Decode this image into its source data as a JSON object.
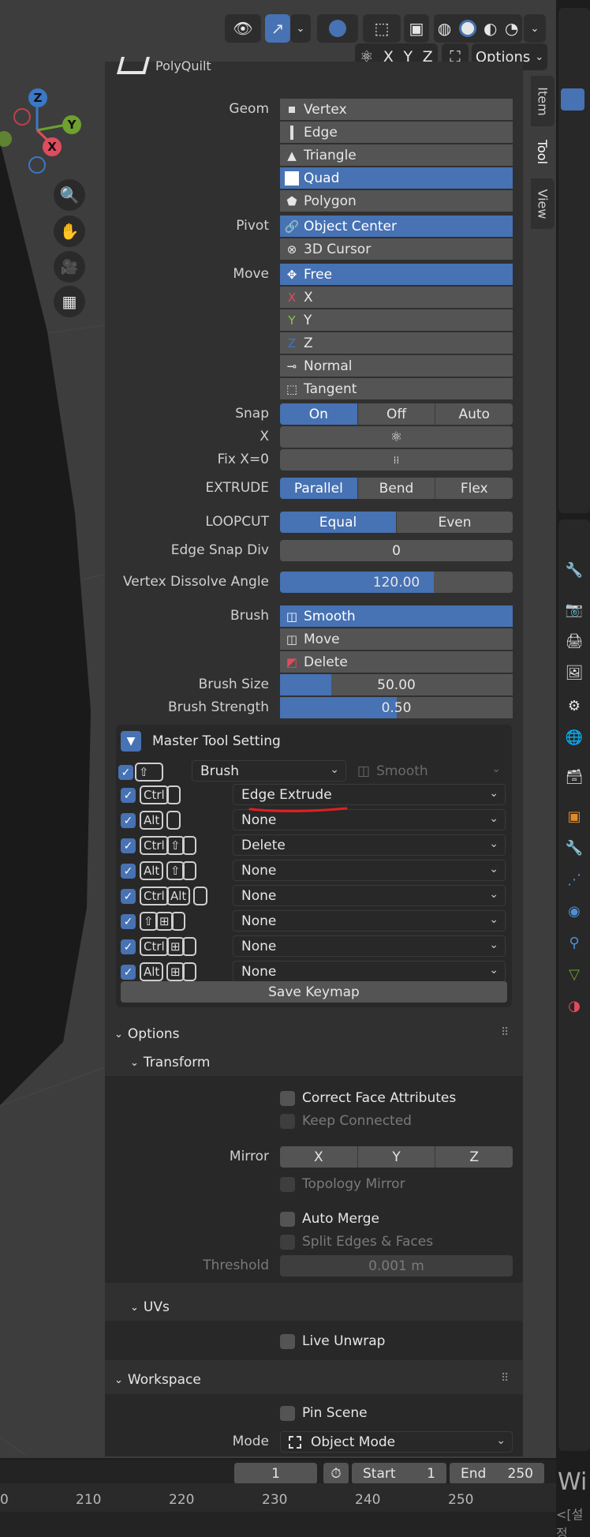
{
  "header": {
    "options_label": "Options",
    "mirror_axes": [
      "X",
      "Y",
      "Z"
    ]
  },
  "gizmo": {
    "z": "Z",
    "y": "Y",
    "x": "X"
  },
  "tool": {
    "name": "PolyQuilt"
  },
  "tabs": [
    "Item",
    "Tool",
    "View"
  ],
  "panel": {
    "geom_label": "Geom",
    "geom_items": [
      "Vertex",
      "Edge",
      "Triangle",
      "Quad",
      "Polygon"
    ],
    "pivot_label": "Pivot",
    "pivot_items": [
      "Object Center",
      "3D Cursor"
    ],
    "move_label": "Move",
    "move_items": [
      "Free",
      "X",
      "Y",
      "Z",
      "Normal",
      "Tangent"
    ],
    "move_icons": {
      "x": "X",
      "y": "Y",
      "z": "Z"
    },
    "snap_label": "Snap",
    "snap_options": [
      "On",
      "Off",
      "Auto"
    ],
    "x_label": "X",
    "fixx_label": "Fix X=0",
    "extrude_label": "EXTRUDE",
    "extrude_options": [
      "Parallel",
      "Bend",
      "Flex"
    ],
    "loopcut_label": "LOOPCUT",
    "loopcut_options": [
      "Equal",
      "Even"
    ],
    "edge_snap_label": "Edge Snap Div",
    "edge_snap_value": "0",
    "dissolve_label": "Vertex Dissolve Angle",
    "dissolve_value": "120.00",
    "dissolve_fill": 0.66,
    "brush_label": "Brush",
    "brush_items": [
      "Smooth",
      "Move",
      "Delete"
    ],
    "brush_size_label": "Brush Size",
    "brush_size_value": "50.00",
    "brush_size_fill": 0.22,
    "brush_strength_label": "Brush Strength",
    "brush_strength_value": "0.50",
    "brush_strength_fill": 0.5
  },
  "master": {
    "title": "Master Tool Setting",
    "brush_dropdown": "Brush",
    "brush_smooth": "Smooth",
    "rows": [
      {
        "keys": [
          "Ctrl"
        ],
        "action": "Edge Extrude"
      },
      {
        "keys": [
          "Alt"
        ],
        "action": "None"
      },
      {
        "keys": [
          "Ctrl",
          "⇧"
        ],
        "action": "Delete"
      },
      {
        "keys": [
          "Alt",
          "⇧"
        ],
        "action": "None"
      },
      {
        "keys": [
          "Ctrl",
          "Alt"
        ],
        "action": "None"
      },
      {
        "keys": [
          "⇧",
          "⊞"
        ],
        "action": "None"
      },
      {
        "keys": [
          "Ctrl",
          "⊞"
        ],
        "action": "None"
      },
      {
        "keys": [
          "Alt",
          "⊞"
        ],
        "action": "None"
      }
    ],
    "save_label": "Save Keymap"
  },
  "options": {
    "title": "Options",
    "transform_title": "Transform",
    "correct_face": "Correct Face Attributes",
    "keep_connected": "Keep Connected",
    "mirror_label": "Mirror",
    "mirror_axes": [
      "X",
      "Y",
      "Z"
    ],
    "topology_mirror": "Topology Mirror",
    "auto_merge": "Auto Merge",
    "split_edges": "Split Edges & Faces",
    "threshold_label": "Threshold",
    "threshold_value": "0.001 m",
    "uvs_title": "UVs",
    "live_unwrap": "Live Unwrap"
  },
  "workspace": {
    "title": "Workspace",
    "pin_scene": "Pin Scene",
    "mode_label": "Mode",
    "mode_value": "Object Mode"
  },
  "timeline": {
    "current_frame": "1",
    "start_label": "Start",
    "start_value": "1",
    "end_label": "End",
    "end_value": "250",
    "ticks": [
      "0",
      "210",
      "220",
      "230",
      "240",
      "250"
    ]
  },
  "right_strip": {
    "text1": "Wi",
    "text2": "<[설정"
  },
  "colors": {
    "accent": "#4772b3",
    "panel": "#303030",
    "button": "#545454",
    "annotation": "#e0201f"
  }
}
